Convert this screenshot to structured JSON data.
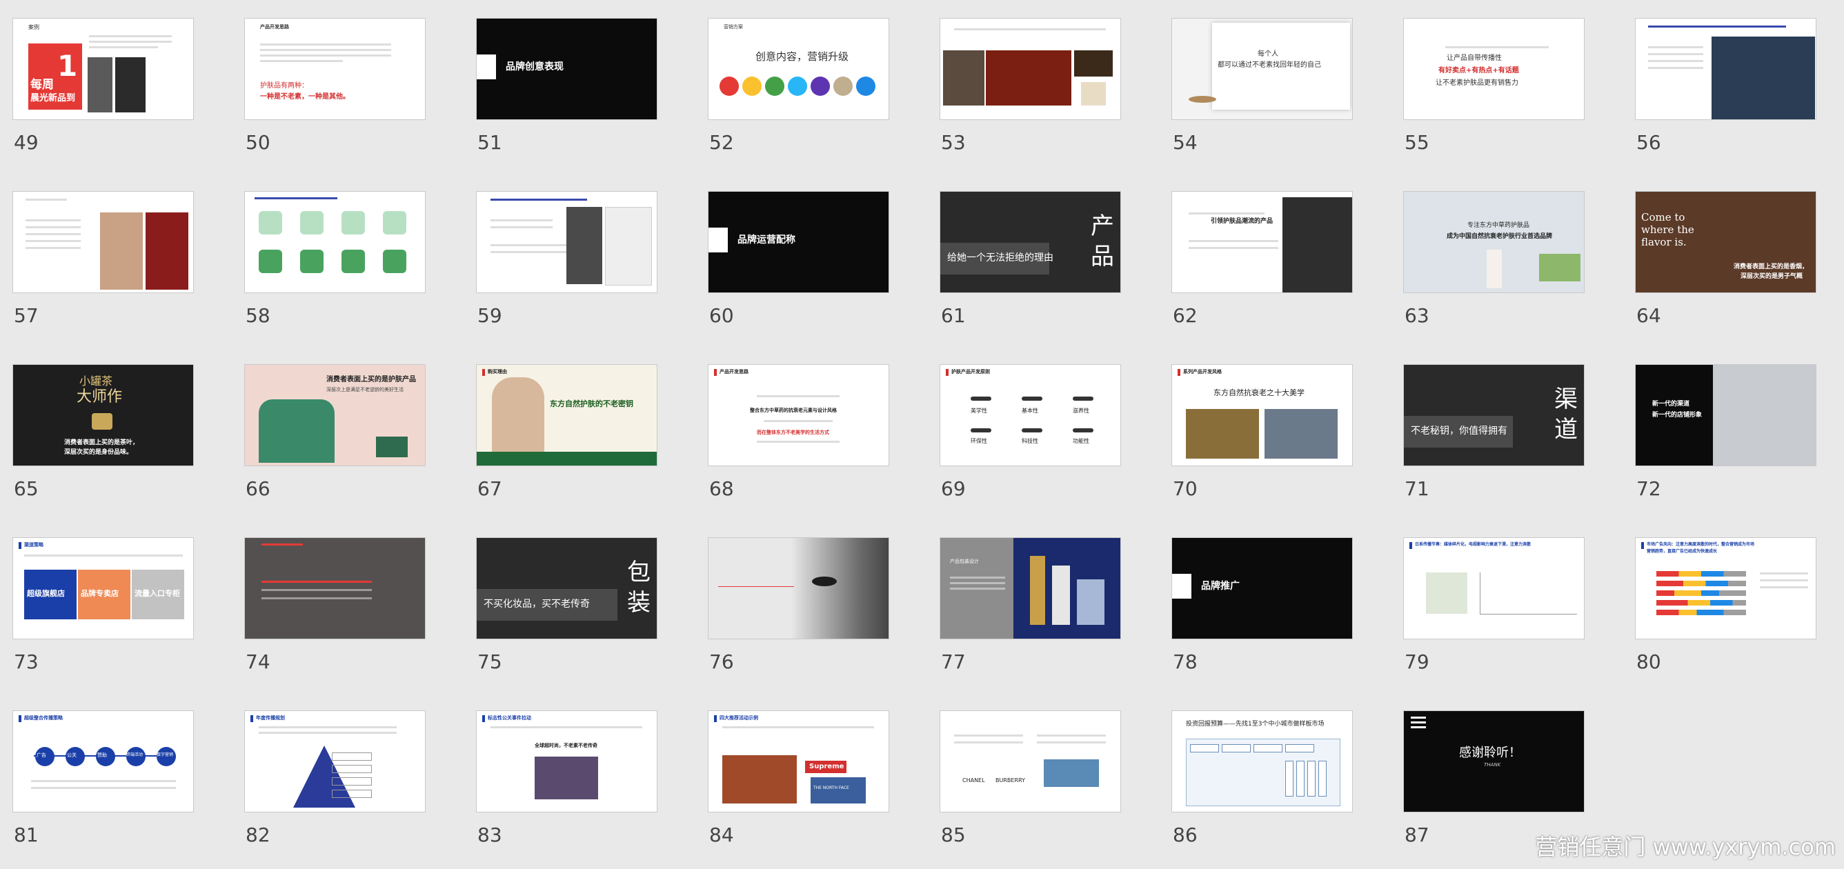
{
  "slides": [
    {
      "n": "49",
      "texts": [
        "案例",
        "每周",
        "1",
        "晨光新品到"
      ]
    },
    {
      "n": "50",
      "texts": [
        "产品开发思路",
        "护肤品有两种：",
        "一种是不老素，一种是其他。"
      ]
    },
    {
      "n": "51",
      "texts": [
        "品牌创意表现"
      ]
    },
    {
      "n": "52",
      "texts": [
        "营销方案",
        "创意内容，营销升级"
      ]
    },
    {
      "n": "53",
      "texts": []
    },
    {
      "n": "54",
      "texts": [
        "每个人",
        "都可以通过不老素找回年轻的自己"
      ]
    },
    {
      "n": "55",
      "texts": [
        "让产品自带传播性",
        "有好卖点+有热点+有话题",
        "让不老素护肤品更有销售力"
      ]
    },
    {
      "n": "56",
      "texts": []
    },
    {
      "n": "57",
      "texts": []
    },
    {
      "n": "58",
      "texts": []
    },
    {
      "n": "59",
      "texts": []
    },
    {
      "n": "60",
      "texts": [
        "品牌运营配称"
      ]
    },
    {
      "n": "61",
      "texts": [
        "产",
        "品",
        "给她一个无法拒绝的理由"
      ]
    },
    {
      "n": "62",
      "texts": [
        "引领护肤品潮流的产品"
      ]
    },
    {
      "n": "63",
      "texts": [
        "专注东方中草药护肤品",
        "成为中国自然抗衰老护肤行业首选品牌"
      ]
    },
    {
      "n": "64",
      "texts": [
        "Come to",
        "where the",
        "flavor is.",
        "消费者表面上买的是香烟，",
        "深层次买的是男子气概"
      ]
    },
    {
      "n": "65",
      "texts": [
        "小罐茶",
        "大师作",
        "消费者表面上买的是茶叶，",
        "深层次买的是身份品味。"
      ]
    },
    {
      "n": "66",
      "texts": [
        "消费者表面上买的是护肤产品",
        "深层次上是满足不老逆龄的美好生活"
      ]
    },
    {
      "n": "67",
      "texts": [
        "购买理由",
        "东方自然护肤的不老密钥"
      ]
    },
    {
      "n": "68",
      "texts": [
        "产品开发思路",
        "整合东方中草药的抗衰老元素与设计风格",
        "而在整体东方不老美学的生活方式"
      ]
    },
    {
      "n": "69",
      "texts": [
        "护肤产品开发原则",
        "美学性",
        "基本性",
        "滋养性",
        "环保性",
        "科技性",
        "功能性"
      ]
    },
    {
      "n": "70",
      "texts": [
        "系列产品开发风格",
        "东方自然抗衰老之十大美学"
      ]
    },
    {
      "n": "71",
      "texts": [
        "渠",
        "道",
        "不老秘钥，你值得拥有"
      ]
    },
    {
      "n": "72",
      "texts": [
        "新一代的渠道",
        "新一代的店铺形象"
      ]
    },
    {
      "n": "73",
      "texts": [
        "渠道策略",
        "超级旗舰店",
        "品牌专卖店",
        "流量入口专柜"
      ]
    },
    {
      "n": "74",
      "texts": []
    },
    {
      "n": "75",
      "texts": [
        "包",
        "装",
        "不买化妆品，买不老传奇"
      ]
    },
    {
      "n": "76",
      "texts": []
    },
    {
      "n": "77",
      "texts": [
        "产品包装设计"
      ]
    },
    {
      "n": "78",
      "texts": [
        "品牌推广"
      ]
    },
    {
      "n": "79",
      "texts": [
        "日系传播节奏：媒体碎片化，电视影响力衰退下滑，注意力涣散"
      ]
    },
    {
      "n": "80",
      "texts": [
        "市场广告风向：注意力高度涣散的时代，整合营销成为市场",
        "营销趋势，直接广告已经成为快速成长"
      ]
    },
    {
      "n": "81",
      "texts": [
        "超级整合传播策略",
        "广告",
        "公关",
        "赞助",
        "终端活动",
        "数字营销"
      ]
    },
    {
      "n": "82",
      "texts": [
        "年度传播规划"
      ]
    },
    {
      "n": "83",
      "texts": [
        "标志性公关事件拉动",
        "全球超时尚，不老素不老传奇"
      ]
    },
    {
      "n": "84",
      "texts": [
        "四大推荐活动示例",
        "Supreme",
        "THE NORTH FACE"
      ]
    },
    {
      "n": "85",
      "texts": [
        "CHANEL",
        "BURBERRY"
      ]
    },
    {
      "n": "86",
      "texts": [
        "投资回报预算——先找1至3个中小城市做样板市场"
      ]
    },
    {
      "n": "87",
      "texts": [
        "感谢聆听！",
        "THANK"
      ]
    }
  ],
  "circles_52": [
    "#e53935",
    "#fbc02d",
    "#43a047",
    "#29b6f6",
    "#5e35b1",
    "#bfae8f",
    "#1e88e5"
  ],
  "watermark": "营销任意门 www.yxrym.com"
}
